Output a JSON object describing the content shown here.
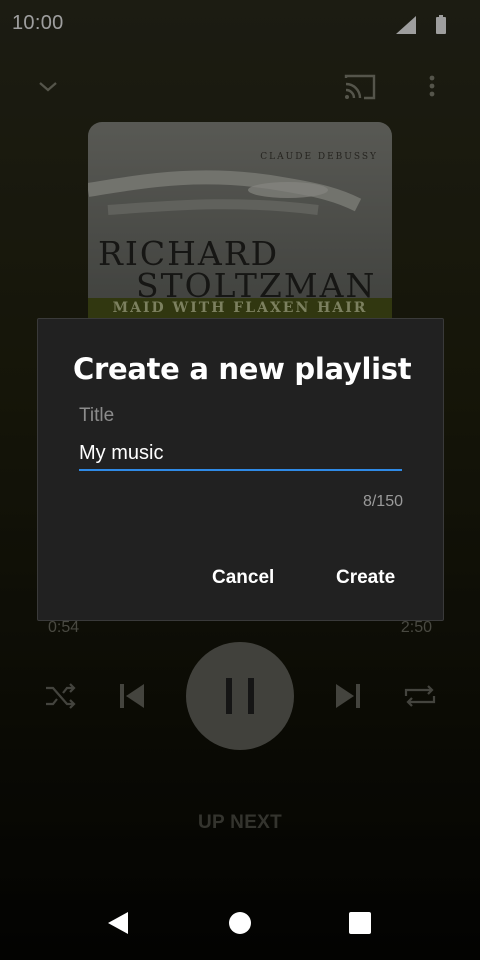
{
  "status_bar": {
    "time": "10:00"
  },
  "player": {
    "album_art": {
      "composer": "CLAUDE DEBUSSY",
      "artist_line1": "RICHARD",
      "artist_line2": "STOLTZMAN",
      "subtitle": "MAID WITH FLAXEN HAIR"
    },
    "time_elapsed": "0:54",
    "time_total": "2:50",
    "up_next_label": "UP NEXT",
    "icons": [
      "chevron-down-icon",
      "cast-icon",
      "more-vert-icon",
      "shuffle-icon",
      "skip-previous-icon",
      "pause-icon",
      "skip-next-icon",
      "repeat-icon"
    ]
  },
  "dialog": {
    "title": "Create a new playlist",
    "field_label": "Title",
    "field_value": "My music",
    "char_count": "8/150",
    "cancel_label": "Cancel",
    "create_label": "Create",
    "accent_color": "#2f8ae6"
  },
  "nav_bar": {
    "icons": [
      "back-icon",
      "home-icon",
      "recents-icon"
    ]
  }
}
